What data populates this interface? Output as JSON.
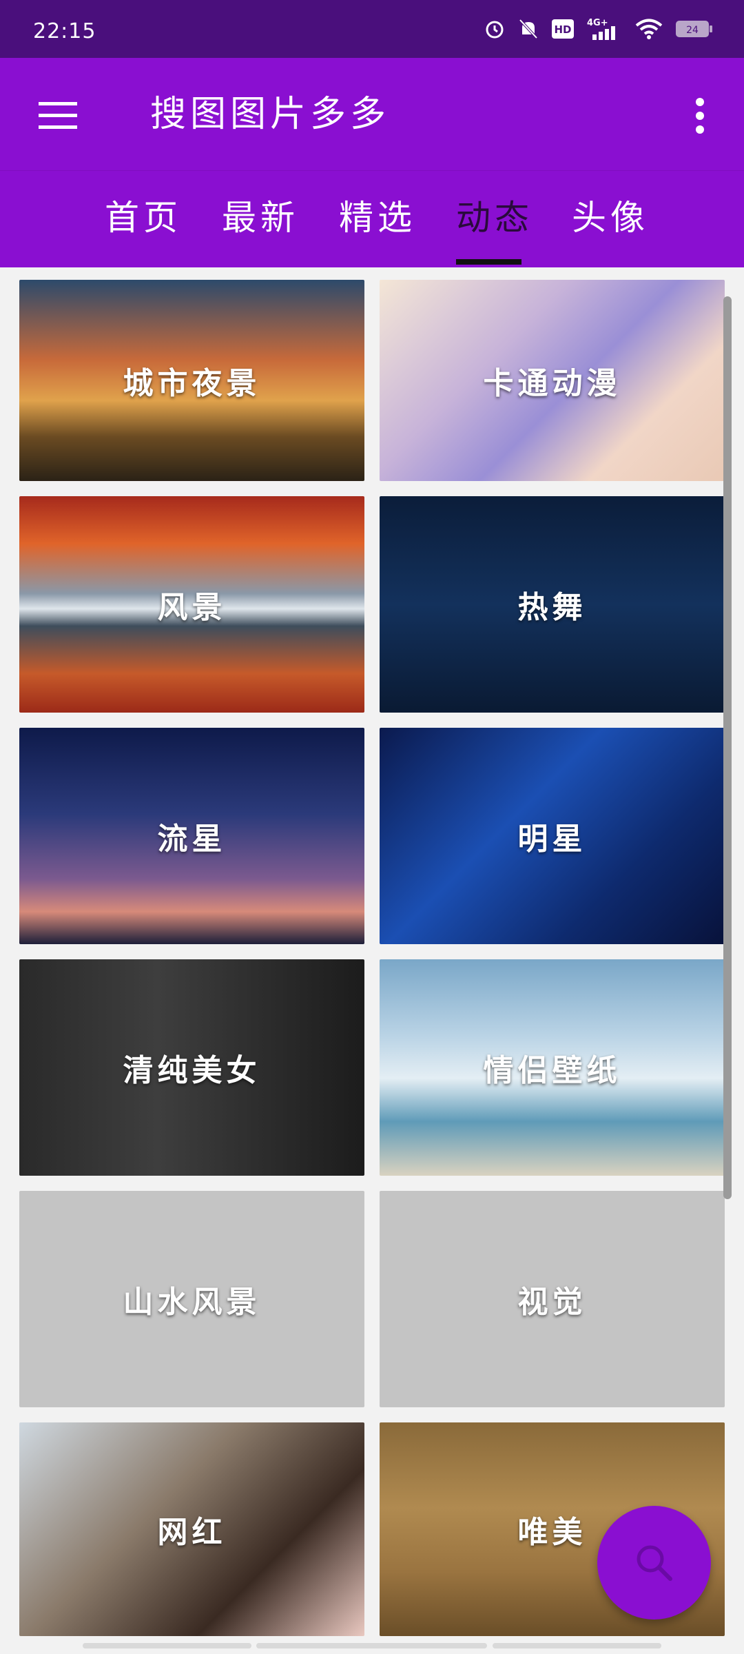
{
  "status_bar": {
    "time": "22:15",
    "battery": "24",
    "network": "4G+"
  },
  "app": {
    "title": "搜图图片多多"
  },
  "tabs": [
    {
      "label": "首页",
      "active": false
    },
    {
      "label": "最新",
      "active": false
    },
    {
      "label": "精选",
      "active": false
    },
    {
      "label": "动态",
      "active": true
    },
    {
      "label": "头像",
      "active": false
    }
  ],
  "categories": [
    {
      "label": "城市夜景"
    },
    {
      "label": "卡通动漫"
    },
    {
      "label": "风景"
    },
    {
      "label": "热舞"
    },
    {
      "label": "流星"
    },
    {
      "label": "明星"
    },
    {
      "label": "清纯美女"
    },
    {
      "label": "情侣壁纸"
    },
    {
      "label": "山水风景"
    },
    {
      "label": "视觉"
    },
    {
      "label": "网红"
    },
    {
      "label": "唯美"
    }
  ],
  "fab": {
    "icon": "search-icon"
  },
  "colors": {
    "primary": "#8a0fd1",
    "status_bar": "#4a0f7c"
  }
}
